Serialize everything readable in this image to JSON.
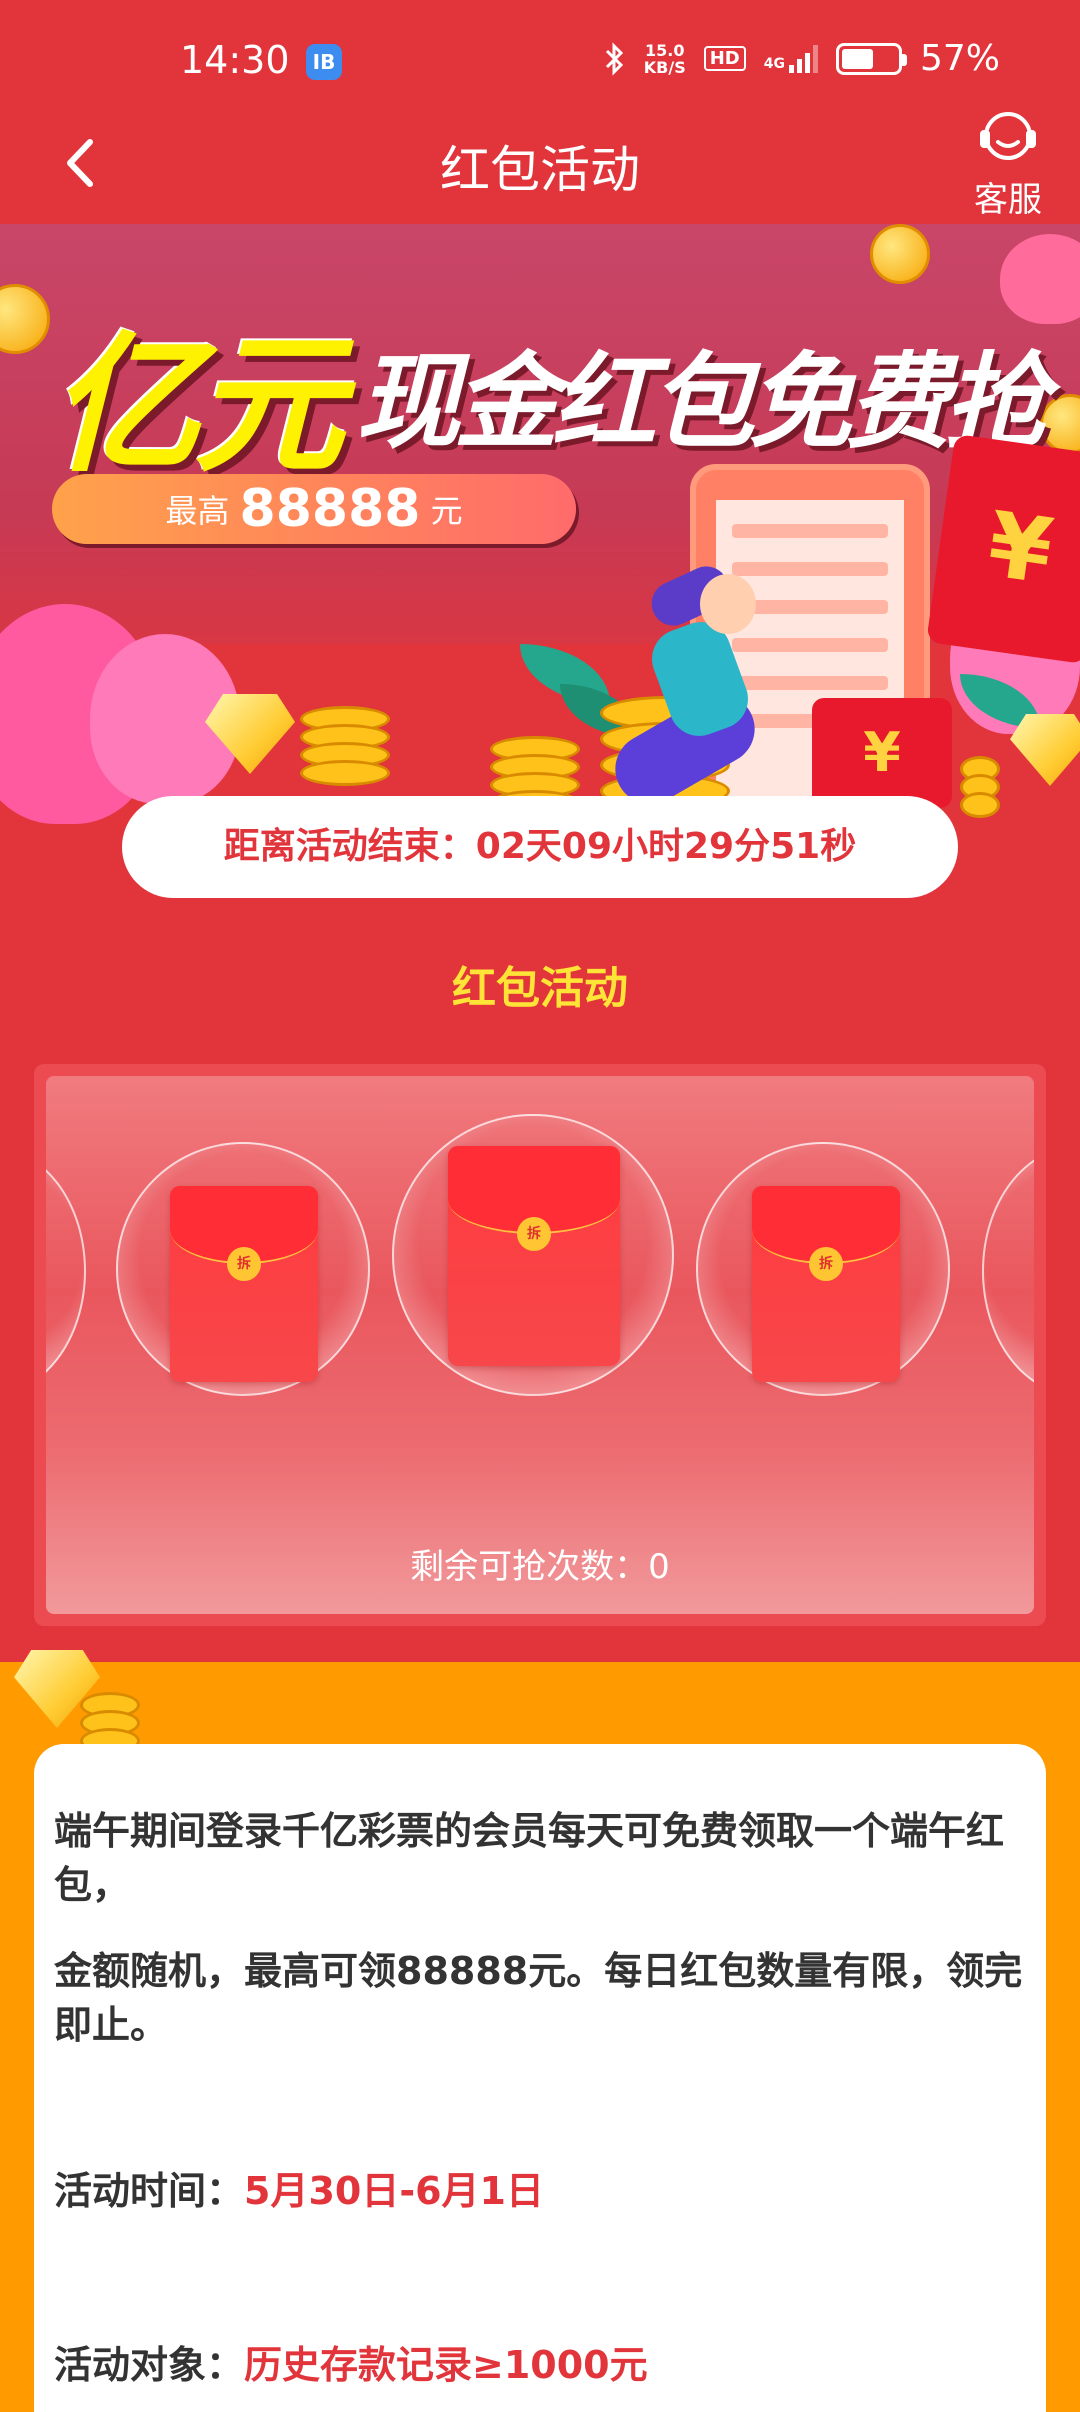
{
  "status_bar": {
    "time": "14:30",
    "app_badge": "IB",
    "net_speed_value": "15.0",
    "net_speed_unit": "KB/S",
    "hd": "HD",
    "network": "4G",
    "battery": "57%",
    "battery_level": 0.57
  },
  "nav": {
    "title": "红包活动",
    "service_label": "客服"
  },
  "banner": {
    "big_text": "亿元",
    "sub_text": "现金红包免费抢",
    "pill_prefix": "最高",
    "pill_amount": "88888",
    "pill_suffix": "元",
    "envelope_symbol": "¥"
  },
  "countdown": {
    "text": "距离活动结束：02天09小时29分51秒"
  },
  "section": {
    "title": "红包活动"
  },
  "panel": {
    "packet_seal": "拆",
    "remaining_text": "剩余可抢次数：0"
  },
  "info": {
    "para1": "端午期间登录千亿彩票的会员每天可免费领取一个端午红包，",
    "para2": "金额随机，最高可领88888元。每日红包数量有限，领完即止。",
    "time_label": "活动时间：",
    "time_value": "5月30日-6月1日",
    "target_label": "活动对象：",
    "target_value": "历史存款记录≥1000元"
  },
  "colors": {
    "primary_red": "#e2353b",
    "accent_yellow": "#ffe438",
    "orange": "#ff9a00"
  }
}
